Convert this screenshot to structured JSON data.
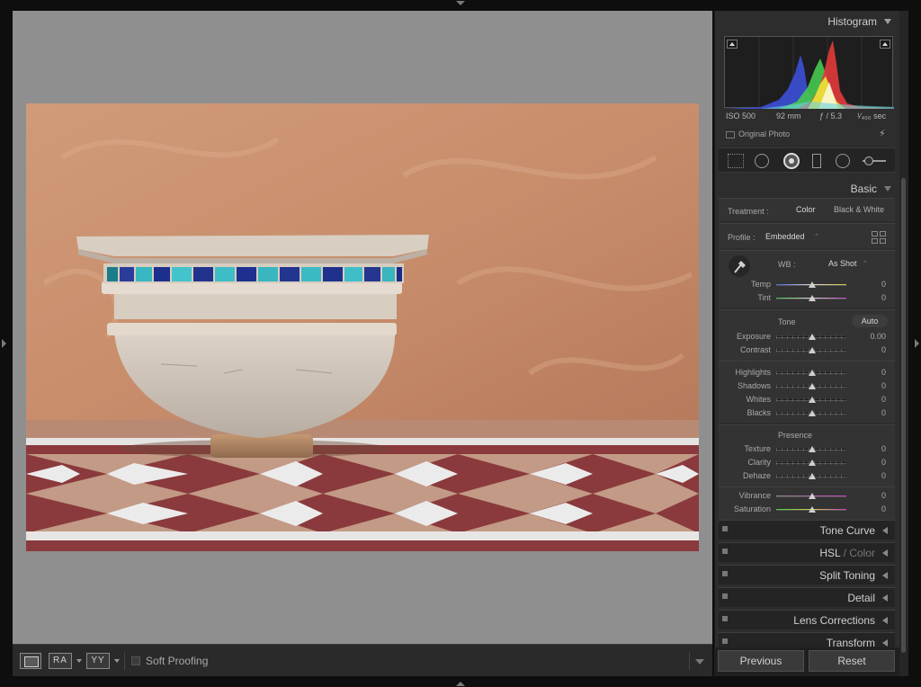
{
  "histogram": {
    "title": "Histogram",
    "exif": {
      "iso": "ISO 500",
      "focal": "92 mm",
      "aperture": "ƒ / 5.3",
      "shutter": "¹⁄₄₀₀ sec"
    },
    "original_photo": "Original Photo"
  },
  "basic": {
    "title": "Basic",
    "treatment_label": "Treatment :",
    "treatment_color": "Color",
    "treatment_bw": "Black & White",
    "profile_label": "Profile :",
    "profile_value": "Embedded",
    "wb_label": "WB :",
    "wb_value": "As Shot",
    "temp_label": "Temp",
    "temp_value": "0",
    "tint_label": "Tint",
    "tint_value": "0",
    "tone_label": "Tone",
    "auto_label": "Auto",
    "exposure_label": "Exposure",
    "exposure_value": "0.00",
    "contrast_label": "Contrast",
    "contrast_value": "0",
    "highlights_label": "Highlights",
    "highlights_value": "0",
    "shadows_label": "Shadows",
    "shadows_value": "0",
    "whites_label": "Whites",
    "whites_value": "0",
    "blacks_label": "Blacks",
    "blacks_value": "0",
    "presence_label": "Presence",
    "texture_label": "Texture",
    "texture_value": "0",
    "clarity_label": "Clarity",
    "clarity_value": "0",
    "dehaze_label": "Dehaze",
    "dehaze_value": "0",
    "vibrance_label": "Vibrance",
    "vibrance_value": "0",
    "saturation_label": "Saturation",
    "saturation_value": "0"
  },
  "panels": {
    "tone_curve": "Tone Curve",
    "hsl": "HSL",
    "hsl_sep": " / ",
    "hsl_color": "Color",
    "split_toning": "Split Toning",
    "detail": "Detail",
    "lens_corrections": "Lens Corrections",
    "transform": "Transform"
  },
  "toolbar": {
    "ra_label": "RA",
    "yy_label": "YY",
    "soft_proofing": "Soft Proofing"
  },
  "buttons": {
    "previous": "Previous",
    "reset": "Reset"
  },
  "icons": {
    "bolt": "⚡",
    "updown": "⌃"
  }
}
